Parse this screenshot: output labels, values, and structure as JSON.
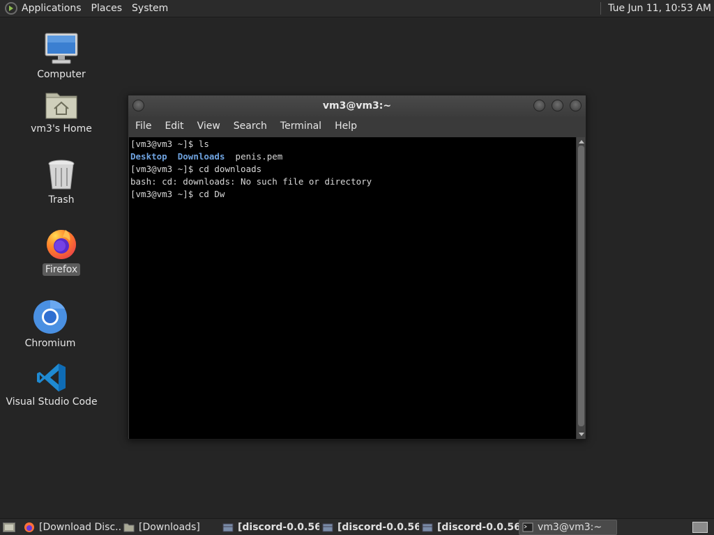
{
  "top_panel": {
    "menus": [
      "Applications",
      "Places",
      "System"
    ],
    "clock": "Tue Jun 11, 10:53 AM"
  },
  "desktop": {
    "icons": [
      {
        "label": "Computer",
        "icon": "computer-icon"
      },
      {
        "label": "vm3's Home",
        "icon": "home-folder-icon"
      },
      {
        "label": "Trash",
        "icon": "trash-icon"
      },
      {
        "label": "Firefox",
        "icon": "firefox-icon"
      },
      {
        "label": "Chromium",
        "icon": "chromium-icon"
      },
      {
        "label": "Visual Studio Code",
        "icon": "vscode-icon"
      }
    ]
  },
  "terminal": {
    "title": "vm3@vm3:~",
    "menu": [
      "File",
      "Edit",
      "View",
      "Search",
      "Terminal",
      "Help"
    ],
    "lines": {
      "l1": "[vm3@vm3 ~]$ ls",
      "l2_dir1": "Desktop",
      "l2_dir2": "Downloads",
      "l2_file": "penis.pem",
      "l3": "[vm3@vm3 ~]$ cd downloads",
      "l4": "bash: cd: downloads: No such file or directory",
      "l5": "[vm3@vm3 ~]$ cd Dw"
    },
    "dir_color": "#6fa3e0"
  },
  "taskbar": {
    "tasks": [
      {
        "label": "[Download Disc...",
        "icon": "firefox-icon"
      },
      {
        "label": "[Downloads]",
        "icon": "folder-icon"
      },
      {
        "label": "[discord-0.0.56...",
        "icon": "package-icon"
      },
      {
        "label": "[discord-0.0.56...",
        "icon": "package-icon"
      },
      {
        "label": "[discord-0.0.56...",
        "icon": "package-icon"
      },
      {
        "label": "vm3@vm3:~",
        "icon": "terminal-icon"
      }
    ]
  }
}
